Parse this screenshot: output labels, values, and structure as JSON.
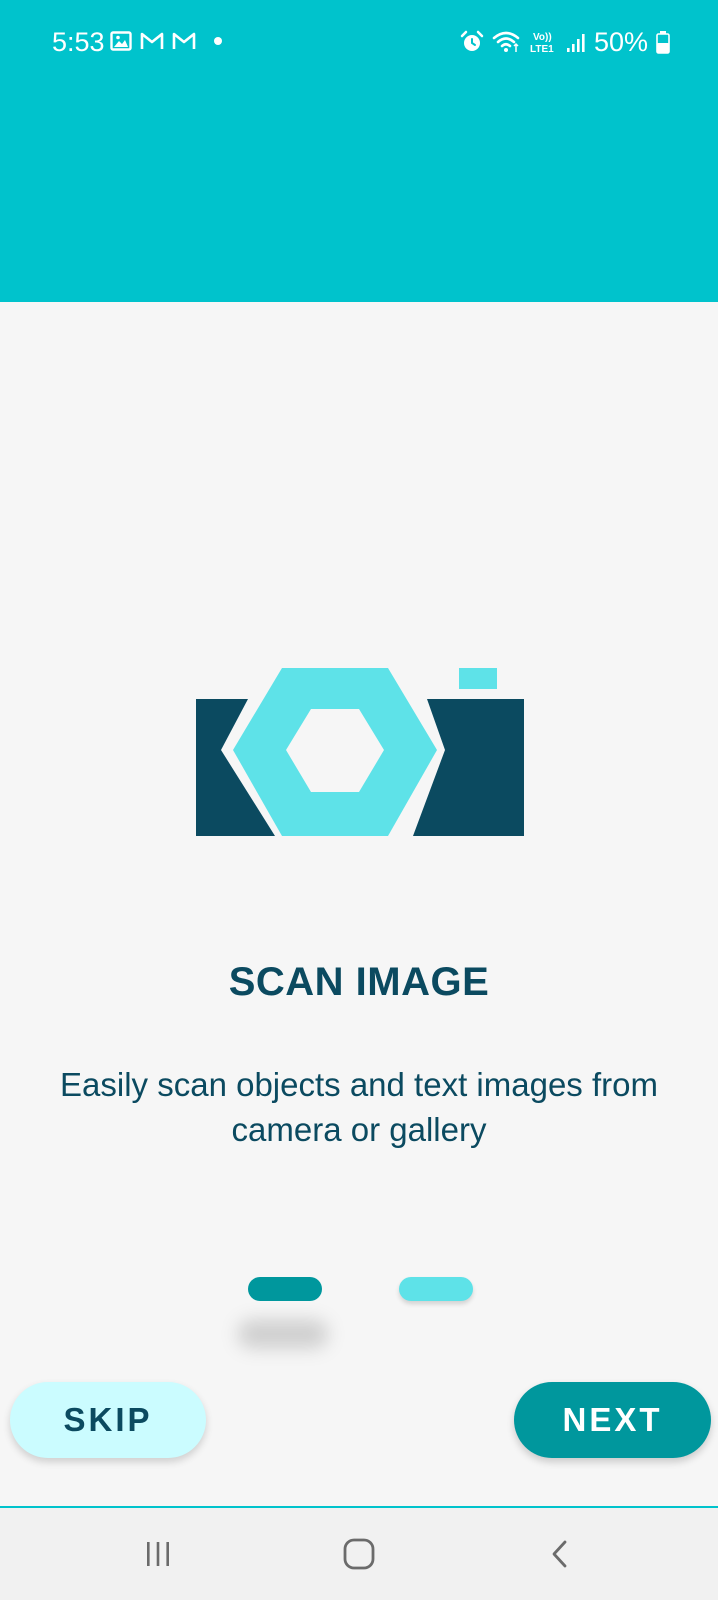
{
  "status_bar": {
    "time": "5:53",
    "left_icons": [
      "gallery-icon",
      "gmail-icon",
      "gmail-icon",
      "notification-dot-icon"
    ],
    "right_icons": [
      "alarm-icon",
      "wifi-icon",
      "volte-lte-icon",
      "signal-icon"
    ],
    "battery": "50%"
  },
  "onboarding": {
    "title": "SCAN IMAGE",
    "description": "Easily scan objects and text images from camera or gallery",
    "page_count": 2,
    "active_page": 1
  },
  "buttons": {
    "skip_label": "SKIP",
    "next_label": "NEXT"
  },
  "nav_bar": {
    "items": [
      "recents-icon",
      "home-icon",
      "back-icon"
    ]
  },
  "colors": {
    "header": "#00c3cc",
    "background": "#f6f6f6",
    "camera_dark": "#0b4a60",
    "camera_light": "#5ee2e8",
    "pager_active": "#00979d",
    "pager_inactive": "#5ee2e8",
    "skip_bg": "#cbfcff",
    "next_bg": "#00979d",
    "text_primary": "#0b4a60"
  }
}
